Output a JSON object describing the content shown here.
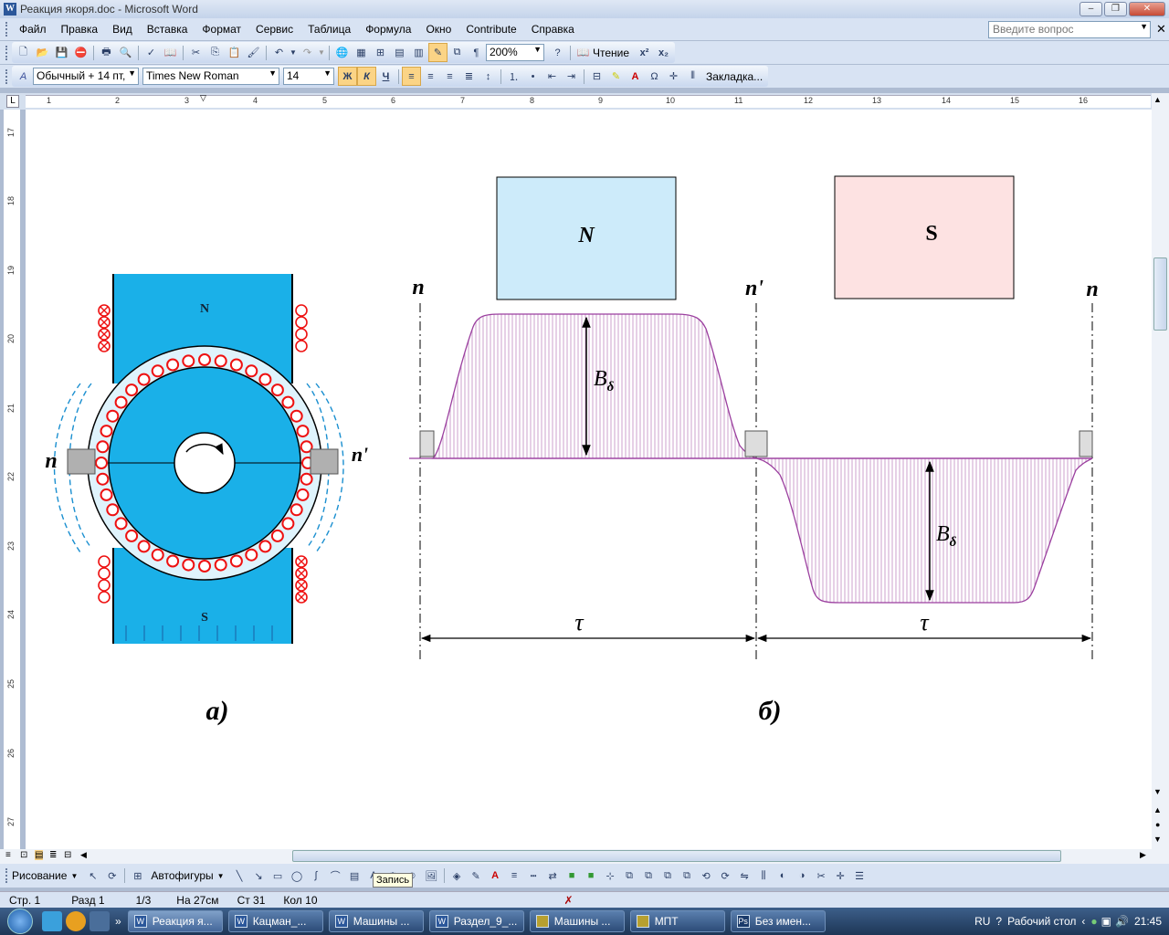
{
  "window": {
    "title": "Реакция якоря.doc - Microsoft Word"
  },
  "menu": [
    "Файл",
    "Правка",
    "Вид",
    "Вставка",
    "Формат",
    "Сервис",
    "Таблица",
    "Формула",
    "Окно",
    "Contribute",
    "Справка"
  ],
  "help_placeholder": "Введите вопрос",
  "toolbar": {
    "zoom": "200%",
    "reading": "Чтение"
  },
  "format": {
    "style": "Обычный + 14 пт,",
    "font": "Times New Roman",
    "size": "14",
    "bold": "Ж",
    "italic": "К",
    "underline": "Ч",
    "bookmark": "Закладка..."
  },
  "ruler_numbers": [
    "1",
    "1",
    "2",
    "3",
    "4",
    "5",
    "6",
    "7",
    "8",
    "9",
    "10",
    "11",
    "12",
    "13",
    "14",
    "15",
    "16"
  ],
  "vruler_numbers": [
    "17",
    "18",
    "19",
    "20",
    "21",
    "22",
    "23",
    "24",
    "25",
    "26",
    "27"
  ],
  "figure": {
    "a_label": "а)",
    "b_label": "б)",
    "pole_n": "N",
    "pole_s": "S",
    "axis_n": "n",
    "axis_n_prime": "n'",
    "tau": "τ",
    "b_delta_main": "B",
    "b_delta_sub": "δ"
  },
  "drawing": {
    "draw": "Рисование",
    "autoshapes": "Автофигуры"
  },
  "tooltip": "Запись",
  "status": {
    "page": "Стр. 1",
    "section": "Разд 1",
    "pages": "1/3",
    "at": "На 27см",
    "line": "Ст 31",
    "col": "Кол 10"
  },
  "taskbar": {
    "tasks": [
      "Реакция я...",
      "Кацман_...",
      "Машины ...",
      "Раздел_9_...",
      "Машины ...",
      "МПТ",
      "Без имен..."
    ],
    "lang": "RU",
    "desktop": "Рабочий стол",
    "time": "21:45"
  },
  "colors": {
    "pole_n_fill": "#cdebfa",
    "pole_s_fill": "#fde2e2",
    "curve": "#9b3f9f",
    "field_blue": "#1ab0e8"
  }
}
